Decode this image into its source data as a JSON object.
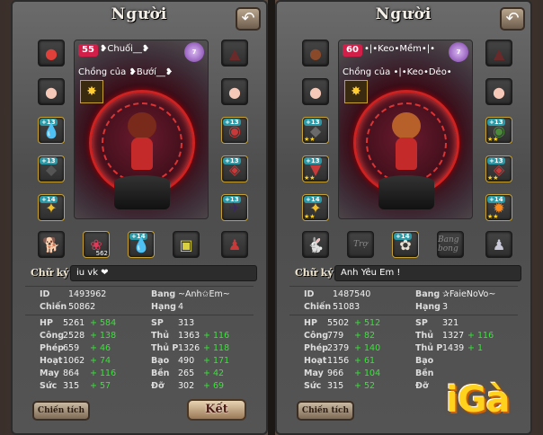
{
  "left": {
    "title": "Người",
    "level": "55",
    "name": "❥Chuối__❥",
    "vip": "7",
    "spouse": "Chồng của ❥Bướí__❥",
    "signature_label": "Chữ ký",
    "signature_value": "iu vk ❤",
    "id_label": "ID",
    "id_value": "1493962",
    "chien_label": "Chiến",
    "chien_value": "50862",
    "bang_label": "Bang",
    "bang_value": "~Anh✩Em~",
    "hang_label": "Hạng",
    "hang_value": "4",
    "stats": [
      {
        "k": "HP",
        "v": "5261",
        "b": "+ 584"
      },
      {
        "k": "Công",
        "v": "2528",
        "b": "+ 138"
      },
      {
        "k": "Phép",
        "v": "659",
        "b": "+ 46"
      },
      {
        "k": "Hoạt",
        "v": "1062",
        "b": "+ 74"
      },
      {
        "k": "May",
        "v": "864",
        "b": "+ 116"
      },
      {
        "k": "Sức",
        "v": "315",
        "b": "+ 57"
      }
    ],
    "stats2": [
      {
        "k": "SP",
        "v": "313",
        "b": ""
      },
      {
        "k": "Thủ",
        "v": "1363",
        "b": "+ 116"
      },
      {
        "k": "Thủ P",
        "v": "1326",
        "b": "+ 118"
      },
      {
        "k": "Bạo",
        "v": "490",
        "b": "+ 171"
      },
      {
        "k": "Bền",
        "v": "265",
        "b": "+ 42"
      },
      {
        "k": "Đỡ",
        "v": "302",
        "b": "+ 69"
      }
    ],
    "btn_chien_tich": "Chiến tích",
    "btn_ket": "Kết"
  },
  "right": {
    "title": "Người",
    "level": "60",
    "name": "•|•Keo•Mềm•|•",
    "vip": "7",
    "spouse": "Chồng của •|•Keo•Dẻo•",
    "signature_label": "Chữ ký",
    "signature_value": "Anh Yêu Em !",
    "id_label": "ID",
    "id_value": "1487540",
    "chien_label": "Chiến",
    "chien_value": "51083",
    "bang_label": "Bang",
    "bang_value": "✰FaieNoVo~",
    "hang_label": "Hạng",
    "hang_value": "3",
    "stats": [
      {
        "k": "HP",
        "v": "5502",
        "b": "+ 512"
      },
      {
        "k": "Công",
        "v": "779",
        "b": "+ 82"
      },
      {
        "k": "Phép",
        "v": "2379",
        "b": "+ 140"
      },
      {
        "k": "Hoạt",
        "v": "1156",
        "b": "+ 61"
      },
      {
        "k": "May",
        "v": "966",
        "b": "+ 104"
      },
      {
        "k": "Sức",
        "v": "315",
        "b": "+ 52"
      }
    ],
    "stats2": [
      {
        "k": "SP",
        "v": "321",
        "b": ""
      },
      {
        "k": "Thủ",
        "v": "1327",
        "b": "+ 116"
      },
      {
        "k": "Thủ P",
        "v": "1439",
        "b": "+ 1"
      },
      {
        "k": "Bạo",
        "v": "",
        "b": ""
      },
      {
        "k": "Bền",
        "v": "",
        "b": ""
      },
      {
        "k": "Đỡ",
        "v": "",
        "b": ""
      }
    ],
    "btn_chien_tich": "Chiến tích",
    "slot_tro": "Trợ",
    "slot_bang_bong": "Bang bong",
    "logo_text": "iGà"
  },
  "badges": {
    "plus13": "+13",
    "plus14": "+14",
    "count": "562"
  },
  "colors": {
    "accent_green": "#38e438",
    "level_badge": "#d21f4a",
    "vip": "#7a3aa8"
  }
}
